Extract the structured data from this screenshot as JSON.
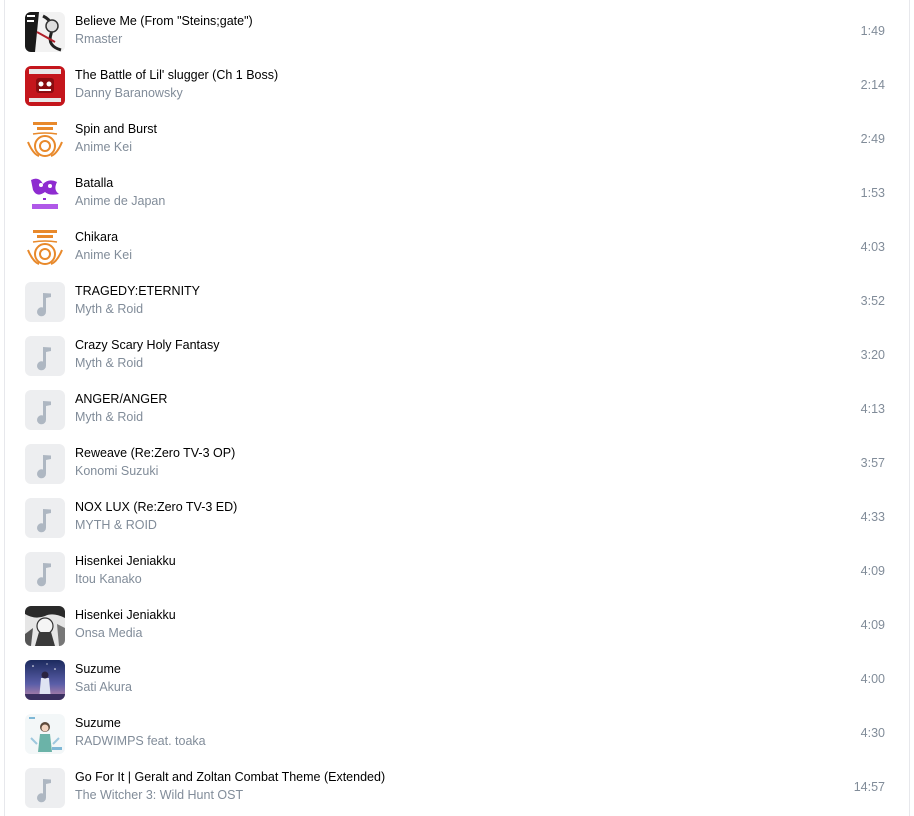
{
  "tracks": [
    {
      "title": "Believe Me (From \"Steins;gate\")",
      "artist": "Rmaster",
      "duration": "1:49",
      "cover": "manga-art-cover"
    },
    {
      "title": "The Battle of Lil' slugger (Ch 1 Boss)",
      "artist": "Danny Baranowsky",
      "duration": "2:14",
      "cover": "red-game-cover"
    },
    {
      "title": "Spin and Burst",
      "artist": "Anime Kei",
      "duration": "2:49",
      "cover": "orange-swirl-cover"
    },
    {
      "title": "Batalla",
      "artist": "Anime de Japan",
      "duration": "1:53",
      "cover": "purple-sketch-cover"
    },
    {
      "title": "Chikara",
      "artist": "Anime Kei",
      "duration": "4:03",
      "cover": "orange-swirl-cover"
    },
    {
      "title": "TRAGEDY:ETERNITY",
      "artist": "Myth & Roid",
      "duration": "3:52",
      "cover": "music-note-placeholder"
    },
    {
      "title": "Crazy Scary Holy Fantasy",
      "artist": "Myth & Roid",
      "duration": "3:20",
      "cover": "music-note-placeholder"
    },
    {
      "title": "ANGER/ANGER",
      "artist": "Myth & Roid",
      "duration": "4:13",
      "cover": "music-note-placeholder"
    },
    {
      "title": "Reweave (Re:Zero TV-3 OP)",
      "artist": "Konomi Suzuki",
      "duration": "3:57",
      "cover": "music-note-placeholder"
    },
    {
      "title": "NOX LUX (Re:Zero TV-3 ED)",
      "artist": "MYTH & ROID",
      "duration": "4:33",
      "cover": "music-note-placeholder"
    },
    {
      "title": "Hisenkei Jeniakku",
      "artist": "Itou Kanako",
      "duration": "4:09",
      "cover": "music-note-placeholder"
    },
    {
      "title": "Hisenkei Jeniakku",
      "artist": "Onsa Media",
      "duration": "4:09",
      "cover": "mono-anime-cover"
    },
    {
      "title": "Suzume",
      "artist": "Sati Akura",
      "duration": "4:00",
      "cover": "night-sky-cover"
    },
    {
      "title": "Suzume",
      "artist": "RADWIMPS feat. toaka",
      "duration": "4:30",
      "cover": "pastel-figure-cover"
    },
    {
      "title": "Go For It | Geralt and Zoltan Combat Theme (Extended)",
      "artist": "The Witcher 3: Wild Hunt OST",
      "duration": "14:57",
      "cover": "music-note-placeholder"
    }
  ],
  "colors": {
    "title_text": "#000000",
    "secondary_text": "#818c99",
    "placeholder_bg": "#edeef0",
    "placeholder_note": "#aeb7c2"
  }
}
